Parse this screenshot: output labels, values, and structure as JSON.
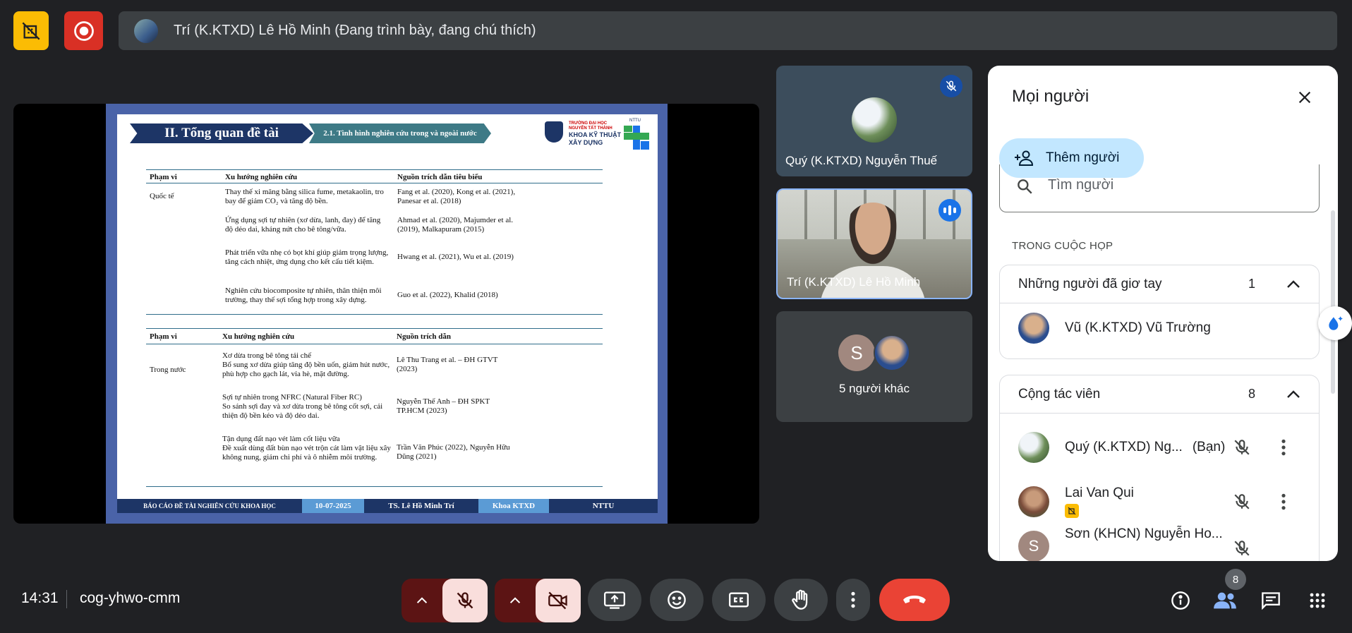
{
  "top": {
    "presenter_text": "Trí (K.KTXD) Lê Hồ Minh (Đang trình bày, đang chú thích)"
  },
  "slide": {
    "title": "II. Tổng quan đề tài",
    "subtitle": "2.1. Tình hình nghiên cứu trong và ngoài nước",
    "logo_line1": "TRƯỜNG ĐẠI HỌC NGUYỄN TẤT THÀNH",
    "logo_line2": "KHOA KỸ THUẬT",
    "logo_line3": "XÂY DỰNG",
    "logo_brand": "NTTU",
    "intl": {
      "h_scope": "Phạm vi",
      "h_trend": "Xu hướng nghiên cứu",
      "h_source": "Nguồn trích dẫn tiêu biểu",
      "scope": "Quốc tế",
      "rows": [
        {
          "trend": "Thay thế xi măng bằng silica fume, metakaolin, tro bay để giảm CO₂ và tăng độ bền.",
          "source": "Fang et al. (2020), Kong et al. (2021), Panesar et al. (2018)"
        },
        {
          "trend": "Ứng dụng sợi tự nhiên (xơ dừa, lanh, đay) để tăng độ dẻo dai, kháng nứt cho bê tông/vữa.",
          "source": "Ahmad et al. (2020), Majumder et al. (2019), Malkapuram (2015)"
        },
        {
          "trend": "Phát triển vữa nhẹ có bọt khí giúp giảm trọng lượng, tăng cách nhiệt, ứng dụng cho kết cấu tiết kiệm.",
          "source": "Hwang et al. (2021), Wu et al. (2019)"
        },
        {
          "trend": "Nghiên cứu biocomposite tự nhiên, thân thiện môi trường, thay thế sợi tổng hợp trong xây dựng.",
          "source": "Guo et al. (2022), Khalid (2018)"
        }
      ]
    },
    "dom": {
      "h_scope": "Phạm vi",
      "h_trend": "Xu hướng nghiên cứu",
      "h_source": "Nguồn trích dẫn",
      "scope": "Trong nước",
      "rows": [
        {
          "trend": "Xơ dừa trong bê tông tái chế\nBổ sung xơ dừa giúp tăng độ bền uốn, giảm hút nước, phù hợp cho gạch lát, vỉa hè, mặt đường.",
          "source": "Lê Thu Trang et al. – ĐH GTVT (2023)"
        },
        {
          "trend": "Sợi tự nhiên trong NFRC (Natural Fiber RC)\nSo sánh sợi đay và xơ dừa trong bê tông cốt sợi, cải thiện độ bền kéo và độ dẻo dai.",
          "source": "Nguyễn Thế Anh – ĐH SPKT TP.HCM (2023)"
        },
        {
          "trend": "Tận dụng đất nạo vét làm cốt liệu vữa\nĐề xuất dùng đất bùn nạo vét trộn cát làm vật liệu xây không nung, giảm chi phí và ô nhiễm môi trường.",
          "source": "Trần Văn Phúc (2022), Nguyễn Hữu Dũng (2021)"
        }
      ]
    },
    "footer": [
      "BÁO CÁO ĐỀ TÀI NGHIÊN CỨU KHOA HỌC",
      "10-07-2025",
      "TS. Lê Hồ Minh Trí",
      "Khoa KTXD",
      "NTTU"
    ]
  },
  "tiles": {
    "t1_name": "Quý (K.KTXD) Nguyễn Thuế",
    "t2_name": "Trí (K.KTXD) Lê Hồ Minh",
    "t3_initial": "S",
    "t3_label": "5 người khác"
  },
  "panel": {
    "title": "Mọi người",
    "add_label": "Thêm người",
    "search_placeholder": "Tìm người",
    "section": "TRONG CUỘC HỌP",
    "raised": {
      "label": "Những người đã giơ tay",
      "count": "1",
      "person": "Vũ (K.KTXD) Vũ Trường"
    },
    "collab": {
      "label": "Cộng tác viên",
      "count": "8",
      "p1": "Quý (K.KTXD) Ng...",
      "p1_tag": "(Bạn)",
      "p2": "Lai Van Qui",
      "p3": "Sơn (KHCN) Nguyễn Ho...",
      "p3_initial": "S"
    }
  },
  "bottom": {
    "clock": "14:31",
    "code": "cog-yhwo-cmm",
    "people_count": "8"
  },
  "colors": {
    "accent": "#c2e7ff",
    "end_call": "#ea4335",
    "rec": "#fbbc04",
    "stop": "#d93025"
  }
}
